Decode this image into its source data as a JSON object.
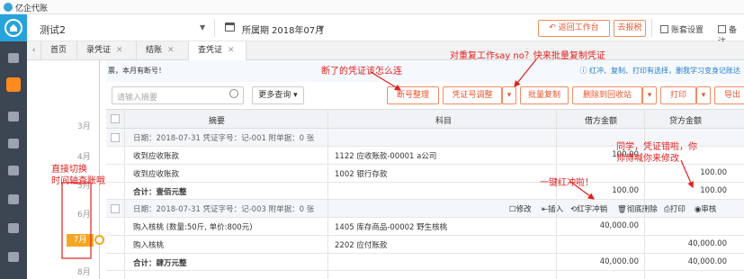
{
  "app": {
    "title": "亿企代账"
  },
  "company": {
    "name": "测试2"
  },
  "period": {
    "label": "所属期",
    "value": "2018年07月"
  },
  "header_buttons": {
    "back": "返回工作台",
    "report": "去报税",
    "settings": "账套设置",
    "backup": "备注"
  },
  "tabs": [
    {
      "label": "首页"
    },
    {
      "label": "录凭证"
    },
    {
      "label": "结账"
    },
    {
      "label": "查凭证"
    }
  ],
  "notice": {
    "left": "票，本月有断号！",
    "right": "红冲、复制、打印有选择，删我学习变身记账达"
  },
  "toolbar": {
    "search_placeholder": "请输入摘要",
    "more_query": "更多查询",
    "renumber": "断号整理",
    "adjust": "凭证号调整",
    "batch_copy": "批量复制",
    "delete_recycle": "删除到回收站",
    "print": "打印",
    "export": "导出"
  },
  "columns": {
    "summary": "摘要",
    "account": "科目",
    "debit": "借方金额",
    "credit": "贷方金额"
  },
  "timeline": [
    "3月",
    "4月",
    "5月",
    "6月",
    "7月",
    "8月"
  ],
  "vouchers": [
    {
      "header": "日期：2018-07-31    凭证字号：记-001    附单据：0 张",
      "lines": [
        {
          "summary": "收到应收账款",
          "account": "1122 应收账款-00001 a公司",
          "debit": "100.00",
          "credit": ""
        },
        {
          "summary": "收到应收账款",
          "account": "1002 银行存款",
          "debit": "",
          "credit": "100.00"
        }
      ],
      "total": {
        "label": "合计：壹佰元整",
        "debit": "100.00",
        "credit": "100.00"
      }
    },
    {
      "header": "日期：2018-07-31    凭证字号：记-003    附单据：0 张",
      "actions": {
        "edit": "修改",
        "insert": "插入",
        "reverse": "红字冲销",
        "delete": "彻底删除",
        "print": "打印",
        "review": "审核"
      },
      "lines": [
        {
          "summary": "购入核桃 (数量:50斤, 单价:800元)",
          "account": "1405 库存商品-00002 野生核桃",
          "debit": "40,000.00",
          "credit": ""
        },
        {
          "summary": "购入核桃",
          "account": "2202 应付账款",
          "debit": "",
          "credit": "40,000.00"
        }
      ],
      "total": {
        "label": "合计：肆万元整",
        "debit": "40,000.00",
        "credit": "40,000.00"
      }
    }
  ],
  "annotations": {
    "a1": "断了的凭证该怎么连",
    "a2": "对重复工作say no？快来批量复制凭证",
    "a3": "直接切换\n时间轴查账哦",
    "a4": "一键红冲啦！",
    "a5": "同学，凭证错啦，你\n师傅喊你来修改"
  },
  "colors": {
    "accent": "#27a3dc",
    "orange": "#f5a623",
    "annotation": "#e02020",
    "sidebar": "#3c4552"
  }
}
